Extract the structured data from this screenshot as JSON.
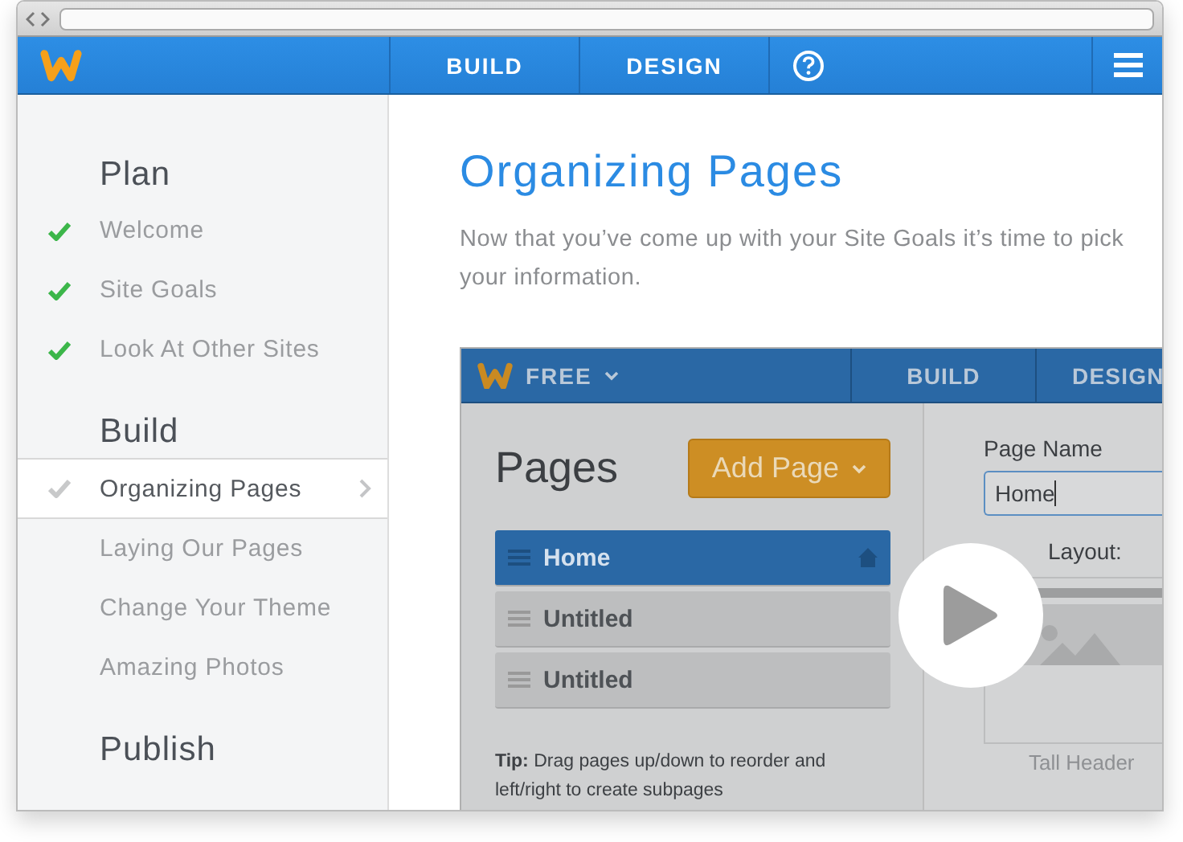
{
  "app_bar": {
    "tabs": [
      {
        "label": "BUILD",
        "selected": false
      },
      {
        "label": "DESIGN",
        "selected": false
      }
    ]
  },
  "sidebar": {
    "sections": [
      {
        "title": "Plan",
        "items": [
          {
            "label": "Welcome",
            "done": true,
            "selected": false
          },
          {
            "label": "Site Goals",
            "done": true,
            "selected": false
          },
          {
            "label": "Look At Other Sites",
            "done": true,
            "selected": false
          }
        ]
      },
      {
        "title": "Build",
        "items": [
          {
            "label": "Organizing Pages",
            "done": false,
            "selected": true
          },
          {
            "label": "Laying Our Pages",
            "done": false,
            "selected": false
          },
          {
            "label": "Change Your Theme",
            "done": false,
            "selected": false
          },
          {
            "label": "Amazing Photos",
            "done": false,
            "selected": false
          }
        ]
      },
      {
        "title": "Publish"
      }
    ]
  },
  "main": {
    "title": "Organizing Pages",
    "paragraph_lines": [
      "Now that you’ve come up with your Site Goals it’s time to pick",
      "your information."
    ],
    "video": {
      "nav": {
        "plan": "FREE",
        "tabs": [
          "BUILD",
          "DESIGN"
        ]
      },
      "pages_title": "Pages",
      "add_button": "Add Page",
      "pages": [
        {
          "label": "Home",
          "selected": true,
          "home": true
        },
        {
          "label": "Untitled",
          "selected": false,
          "home": false
        },
        {
          "label": "Untitled",
          "selected": false,
          "home": false
        }
      ],
      "tip": "**Tip:** Drag pages up/down to reorder and left/right to create subpages",
      "page_name_label": "Page Name",
      "page_name_value": "Home",
      "layout_label": "Layout:",
      "layout_name": "Tall Header"
    }
  }
}
